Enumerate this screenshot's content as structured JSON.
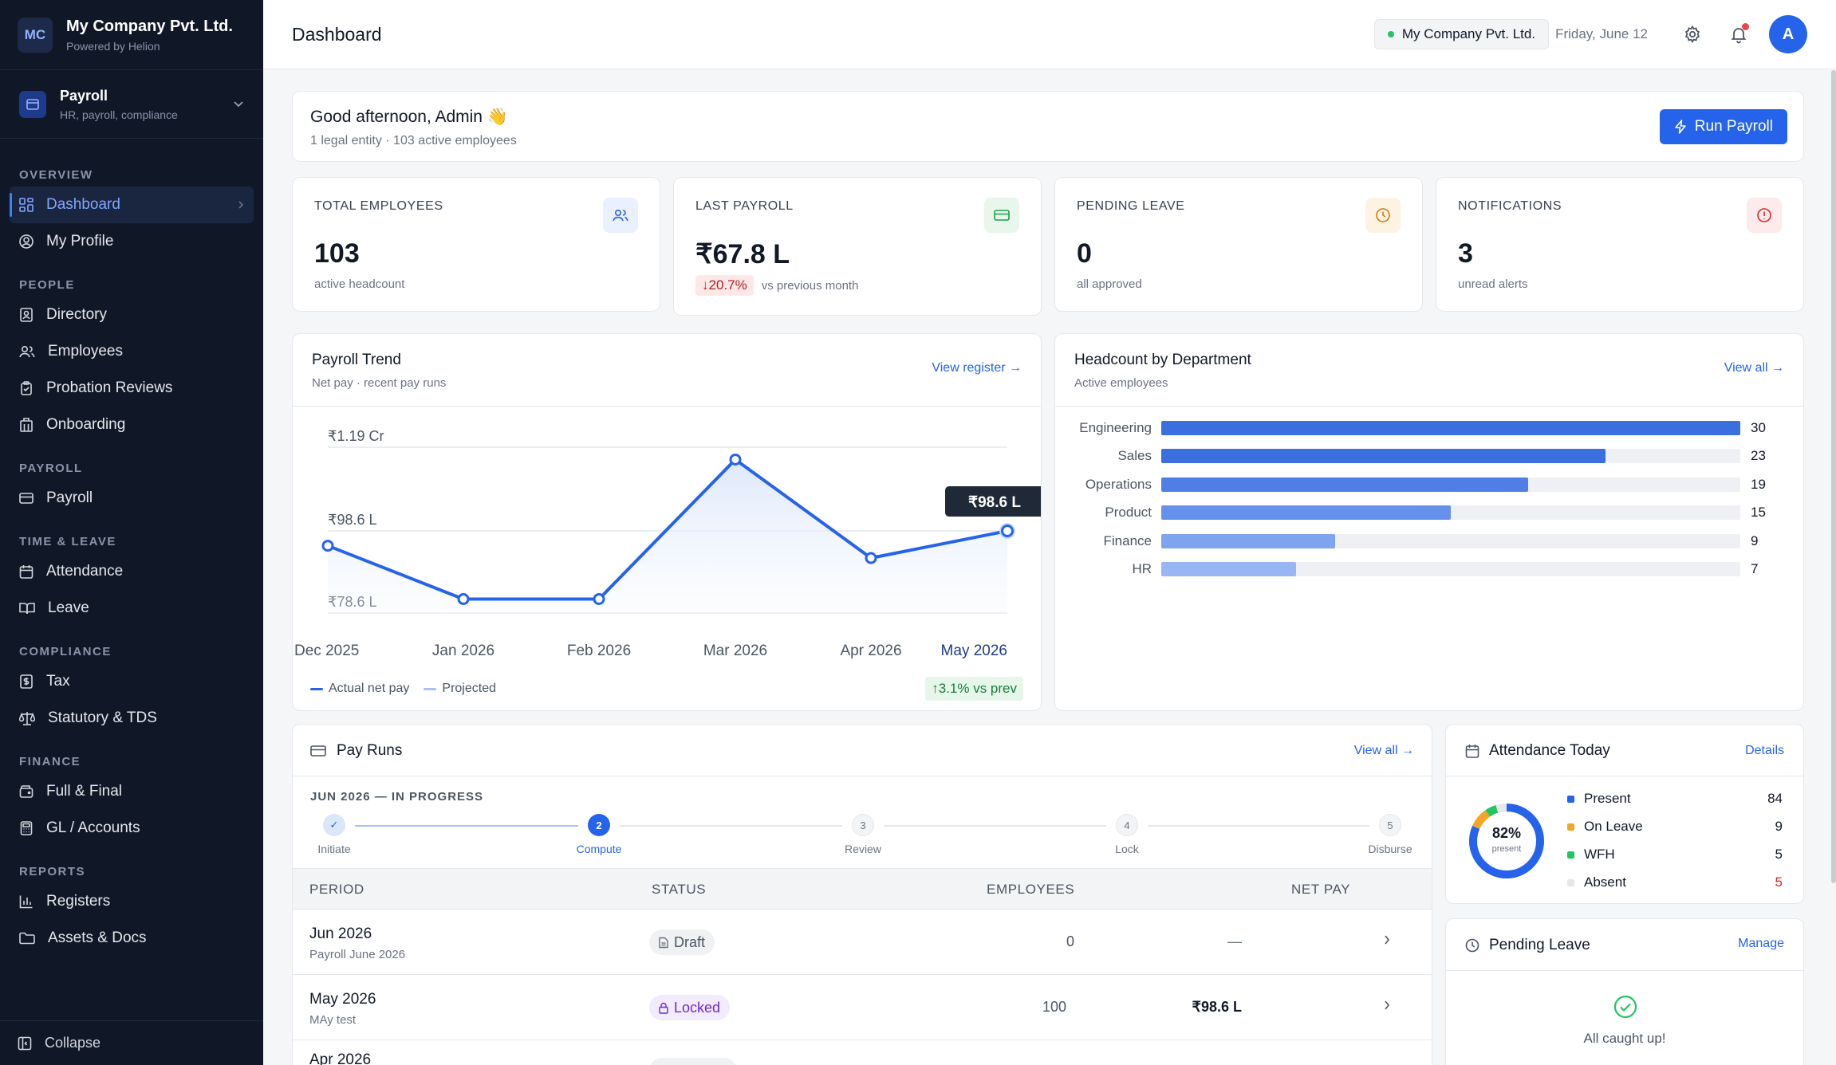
{
  "brand": {
    "initials": "MC",
    "name": "My Company Pvt. Ltd.",
    "sub": "Powered by Helion"
  },
  "module": {
    "name": "Payroll",
    "sub": "HR, payroll, compliance"
  },
  "nav": {
    "overview": "OVERVIEW",
    "dashboard": "Dashboard",
    "profile": "My Profile",
    "people": "PEOPLE",
    "directory": "Directory",
    "employees": "Employees",
    "probation": "Probation Reviews",
    "onboarding": "Onboarding",
    "payroll": "PAYROLL",
    "payroll_item": "Payroll",
    "time": "TIME & LEAVE",
    "attendance": "Attendance",
    "leave": "Leave",
    "compliance": "COMPLIANCE",
    "tax": "Tax",
    "statutory": "Statutory & TDS",
    "finance": "FINANCE",
    "fnf": "Full & Final",
    "gl": "GL / Accounts",
    "reports": "REPORTS",
    "registers": "Registers",
    "assets": "Assets & Docs",
    "collapse": "Collapse"
  },
  "topbar": {
    "title": "Dashboard",
    "company": "My Company Pvt. Ltd.",
    "date": "Friday, June 12",
    "avatar": "A"
  },
  "greeting": {
    "title": "Good afternoon, Admin 👋",
    "sub": "1 legal entity · 103 active employees",
    "run_payroll": "Run Payroll"
  },
  "stats": {
    "employees": {
      "label": "TOTAL EMPLOYEES",
      "value": "103",
      "sub": "active headcount"
    },
    "payroll": {
      "label": "LAST PAYROLL",
      "value": "₹67.8 L",
      "delta": "↓20.7%",
      "sub": "vs previous month"
    },
    "leave": {
      "label": "PENDING LEAVE",
      "value": "0",
      "sub": "all approved"
    },
    "notifications": {
      "label": "NOTIFICATIONS",
      "value": "3",
      "sub": "unread alerts"
    }
  },
  "trend": {
    "title": "Payroll Trend",
    "sub": "Net pay · recent pay runs",
    "link": "View register →",
    "legend_actual": "Actual net pay",
    "legend_projected": "Projected",
    "change": "↑3.1% vs prev",
    "tooltip": "₹98.6 L"
  },
  "chart_data": {
    "type": "line",
    "x": [
      "Dec 2025",
      "Jan 2026",
      "Feb 2026",
      "Mar 2026",
      "Apr 2026",
      "May 2026"
    ],
    "series": [
      {
        "name": "Actual net pay",
        "values": [
          95,
          82,
          82,
          116,
          92,
          98.6
        ]
      }
    ],
    "y_unit": "₹ L",
    "yticks": [
      {
        "value": 78.6,
        "label": "₹78.6 L"
      },
      {
        "value": 98.6,
        "label": "₹98.6 L"
      },
      {
        "value": 119,
        "label": "₹1.19 Cr"
      }
    ],
    "ylim": [
      78.6,
      119
    ],
    "grid": true
  },
  "headcount": {
    "title": "Headcount by Department",
    "sub": "Active employees",
    "link": "View all →",
    "max": 30,
    "departments": [
      {
        "name": "Engineering",
        "count": 30,
        "color": "#3b6fe0"
      },
      {
        "name": "Sales",
        "count": 23,
        "color": "#3b6fe0"
      },
      {
        "name": "Operations",
        "count": 19,
        "color": "#4f7fe6"
      },
      {
        "name": "Product",
        "count": 15,
        "color": "#6591ec"
      },
      {
        "name": "Finance",
        "count": 9,
        "color": "#7ea4f0"
      },
      {
        "name": "HR",
        "count": 7,
        "color": "#98b6f3"
      }
    ]
  },
  "payruns": {
    "title": "Pay Runs",
    "link": "View all →",
    "status": "JUN 2026 — IN PROGRESS",
    "steps": [
      {
        "num": "✓",
        "label": "Initiate"
      },
      {
        "num": "2",
        "label": "Compute"
      },
      {
        "num": "3",
        "label": "Review"
      },
      {
        "num": "4",
        "label": "Lock"
      },
      {
        "num": "5",
        "label": "Disburse"
      }
    ],
    "headers": {
      "period": "PERIOD",
      "status": "STATUS",
      "employees": "EMPLOYEES",
      "net": "NET PAY"
    },
    "rows": [
      {
        "period": "Jun 2026",
        "sub": "Payroll June 2026",
        "status": "Draft",
        "employees": "0",
        "net": "—"
      },
      {
        "period": "May 2026",
        "sub": "MAy test",
        "status": "Locked",
        "employees": "100",
        "net": "₹98.6 L"
      },
      {
        "period": "Apr 2026",
        "sub": "",
        "status": "",
        "employees": "",
        "net": ""
      }
    ]
  },
  "attendance": {
    "title": "Attendance Today",
    "link": "Details",
    "percent": "82%",
    "percent_label": "present",
    "items": [
      {
        "label": "Present",
        "value": "84",
        "color": "#2563eb"
      },
      {
        "label": "On Leave",
        "value": "9",
        "color": "#f5a524"
      },
      {
        "label": "WFH",
        "value": "5",
        "color": "#22c55e"
      },
      {
        "label": "Absent",
        "value": "5",
        "color": "#e5e7eb"
      }
    ]
  },
  "pending_leave": {
    "title": "Pending Leave",
    "link": "Manage",
    "empty": "All caught up!"
  }
}
